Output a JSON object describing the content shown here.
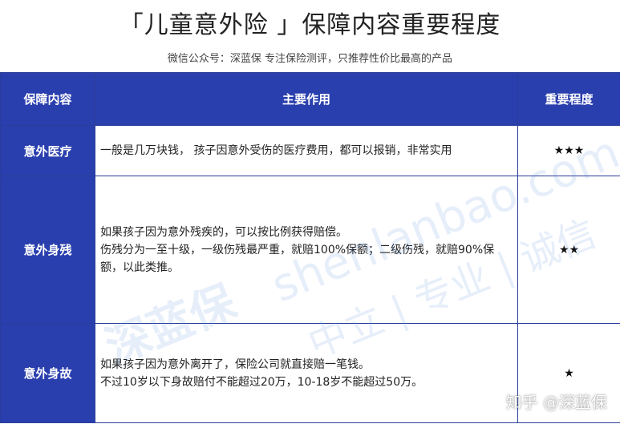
{
  "header": {
    "title": "「儿童意外险 」保障内容重要程度",
    "subtitle": "微信公众号：深蓝保    专注保险测评，只推荐性价比最高的产品"
  },
  "table": {
    "columns": [
      "保障内容",
      "主要作用",
      "重要程度"
    ],
    "rows": [
      {
        "item": "意外医疗",
        "desc": [
          "一般是几万块钱， 孩子因意外受伤的医疗费用，都可以报销，非常实用"
        ],
        "stars": "★★★"
      },
      {
        "item": "意外身残",
        "desc": [
          "如果孩子因为意外残疾的，可以按比例获得赔偿。",
          "伤残分为一至十级，一级伤残最严重，就赔100%保额；二级伤残，就赔90%保额，以此类推。"
        ],
        "stars": "★★"
      },
      {
        "item": "意外身故",
        "desc": [
          "如果孩子因为意外离开了，保险公司就直接赔一笔钱。",
          "不过10岁以下身故赔付不能超过20万，10-18岁不能超过50万。"
        ],
        "stars": "★"
      }
    ]
  },
  "watermark": {
    "logo": "深蓝保",
    "site": "shenlanbao.com",
    "slogan": "中立 | 专业 | 诚信",
    "zhihu": "知乎 @深蓝保"
  },
  "colors": {
    "header_bg": "#2a3fae",
    "header_text": "#ffffff",
    "watermark": "#3c78dc"
  }
}
